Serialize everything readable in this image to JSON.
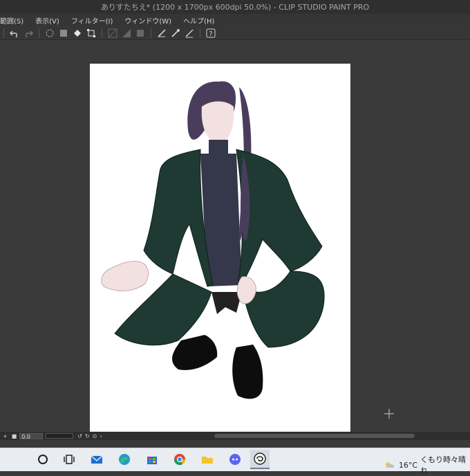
{
  "window": {
    "title": "ありすたちえ* (1200 x 1700px 600dpi 50.0%)  - CLIP STUDIO PAINT PRO"
  },
  "menu": {
    "items": [
      "範囲(S)",
      "表示(V)",
      "フィルター(I)",
      "ウィンドウ(W)",
      "ヘルプ(H)"
    ]
  },
  "toolbar": {
    "icons": [
      "undo-icon",
      "redo-icon",
      "clear-icon",
      "fill-icon",
      "bucket-icon",
      "transform-icon",
      "hide-icon",
      "border-icon",
      "invert-icon",
      "ruler-icon",
      "brush-icon",
      "pen-icon",
      "help-icon"
    ]
  },
  "status": {
    "zoom_value": "0.0"
  },
  "taskbar": {
    "apps": [
      "search-icon",
      "task-view-icon",
      "mail-icon",
      "edge-icon",
      "store-icon",
      "chrome-icon",
      "file-explorer-icon",
      "discord-icon",
      "clip-studio-icon"
    ],
    "weather_temp": "16°C",
    "weather_text": "くもり時々晴れ"
  },
  "colors": {
    "accent": "#1f3a33",
    "hair": "#4a3d5c",
    "shirt": "#34384a"
  }
}
